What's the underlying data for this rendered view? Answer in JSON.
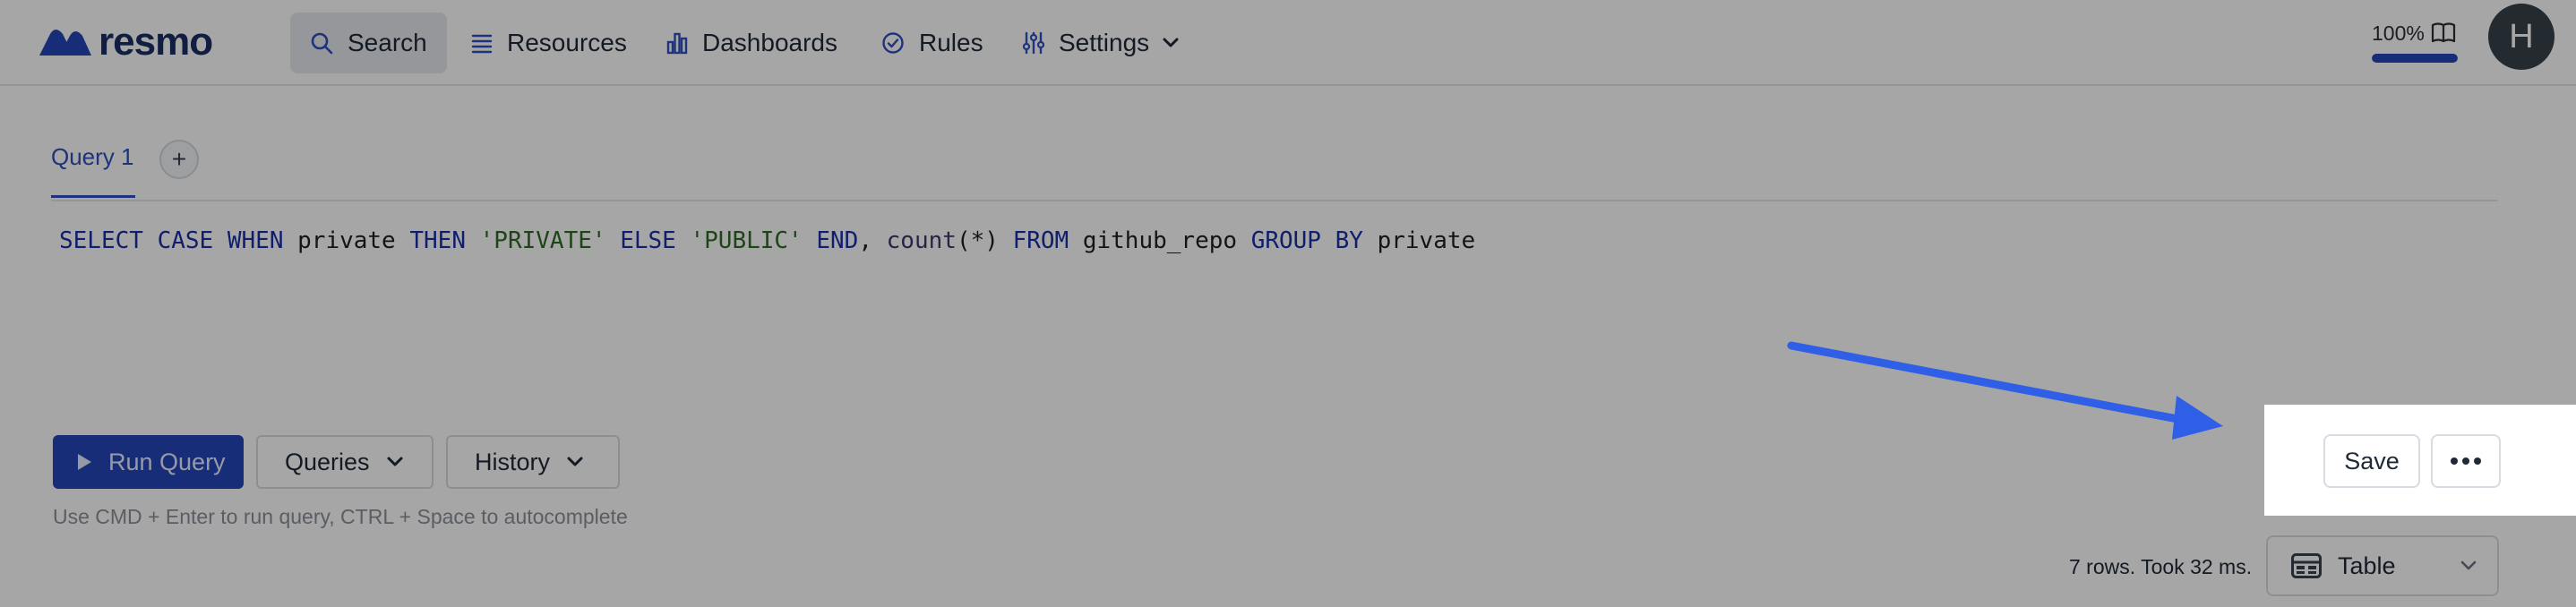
{
  "nav": {
    "brand": "resmo",
    "items": [
      {
        "label": "Search",
        "icon": "search-icon"
      },
      {
        "label": "Resources",
        "icon": "list-icon"
      },
      {
        "label": "Dashboards",
        "icon": "bar-chart-icon"
      },
      {
        "label": "Rules",
        "icon": "check-circle-icon"
      },
      {
        "label": "Settings",
        "icon": "sliders-icon"
      }
    ],
    "progress_label": "100%",
    "progress_value": 1.0,
    "avatar_initial": "H"
  },
  "tabs": [
    {
      "label": "Query 1",
      "active": true
    }
  ],
  "add_tab_label": "+",
  "query": {
    "tokens": [
      {
        "t": "SELECT",
        "k": "kw"
      },
      {
        "t": " "
      },
      {
        "t": "CASE",
        "k": "kw"
      },
      {
        "t": " "
      },
      {
        "t": "WHEN",
        "k": "kw"
      },
      {
        "t": " private "
      },
      {
        "t": "THEN",
        "k": "kw"
      },
      {
        "t": " "
      },
      {
        "t": "'PRIVATE'",
        "k": "str"
      },
      {
        "t": " "
      },
      {
        "t": "ELSE",
        "k": "kw"
      },
      {
        "t": " "
      },
      {
        "t": "'PUBLIC'",
        "k": "str"
      },
      {
        "t": " "
      },
      {
        "t": "END",
        "k": "kw"
      },
      {
        "t": ", "
      },
      {
        "t": "count",
        "k": "fn"
      },
      {
        "t": "(*) "
      },
      {
        "t": "FROM",
        "k": "kw"
      },
      {
        "t": " github_repo "
      },
      {
        "t": "GROUP",
        "k": "kw"
      },
      {
        "t": " "
      },
      {
        "t": "BY",
        "k": "kw"
      },
      {
        "t": " private"
      }
    ]
  },
  "actions": {
    "run_label": "Run Query",
    "queries_label": "Queries",
    "history_label": "History",
    "save_label": "Save",
    "hint": "Use CMD + Enter to run query, CTRL + Space to autocomplete"
  },
  "results": {
    "meta": "7 rows. Took 32 ms.",
    "view_label": "Table"
  },
  "colors": {
    "accent": "#2446b8",
    "annotation_arrow": "#2f5fe6",
    "overlay": "rgba(0,0,0,0.35)"
  }
}
